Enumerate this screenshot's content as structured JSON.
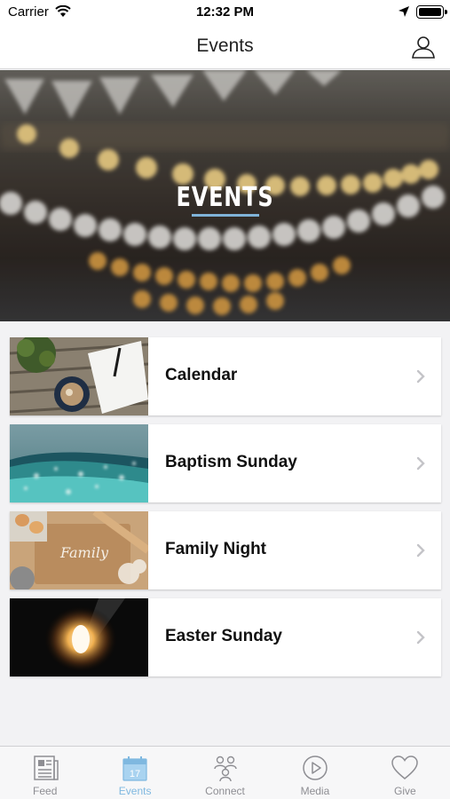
{
  "status_bar": {
    "carrier": "Carrier",
    "time": "12:32 PM"
  },
  "nav": {
    "title": "Events",
    "profile_icon": "person-icon"
  },
  "hero": {
    "title": "EVENTS"
  },
  "events": [
    {
      "label": "Calendar",
      "image": "coffee-notebook-photo"
    },
    {
      "label": "Baptism Sunday",
      "image": "ocean-water-photo"
    },
    {
      "label": "Family Night",
      "image": "family-flour-board-photo"
    },
    {
      "label": "Easter Sunday",
      "image": "empty-tomb-light-photo"
    }
  ],
  "tabs": [
    {
      "label": "Feed",
      "icon": "newspaper-icon",
      "active": false
    },
    {
      "label": "Events",
      "icon": "calendar-icon",
      "active": true,
      "badge": "17"
    },
    {
      "label": "Connect",
      "icon": "people-icon",
      "active": false
    },
    {
      "label": "Media",
      "icon": "play-icon",
      "active": false
    },
    {
      "label": "Give",
      "icon": "heart-icon",
      "active": false
    }
  ],
  "colors": {
    "accent": "#7fb8e0",
    "inactive": "#8e8e93",
    "underline": "#7fb3d8"
  }
}
